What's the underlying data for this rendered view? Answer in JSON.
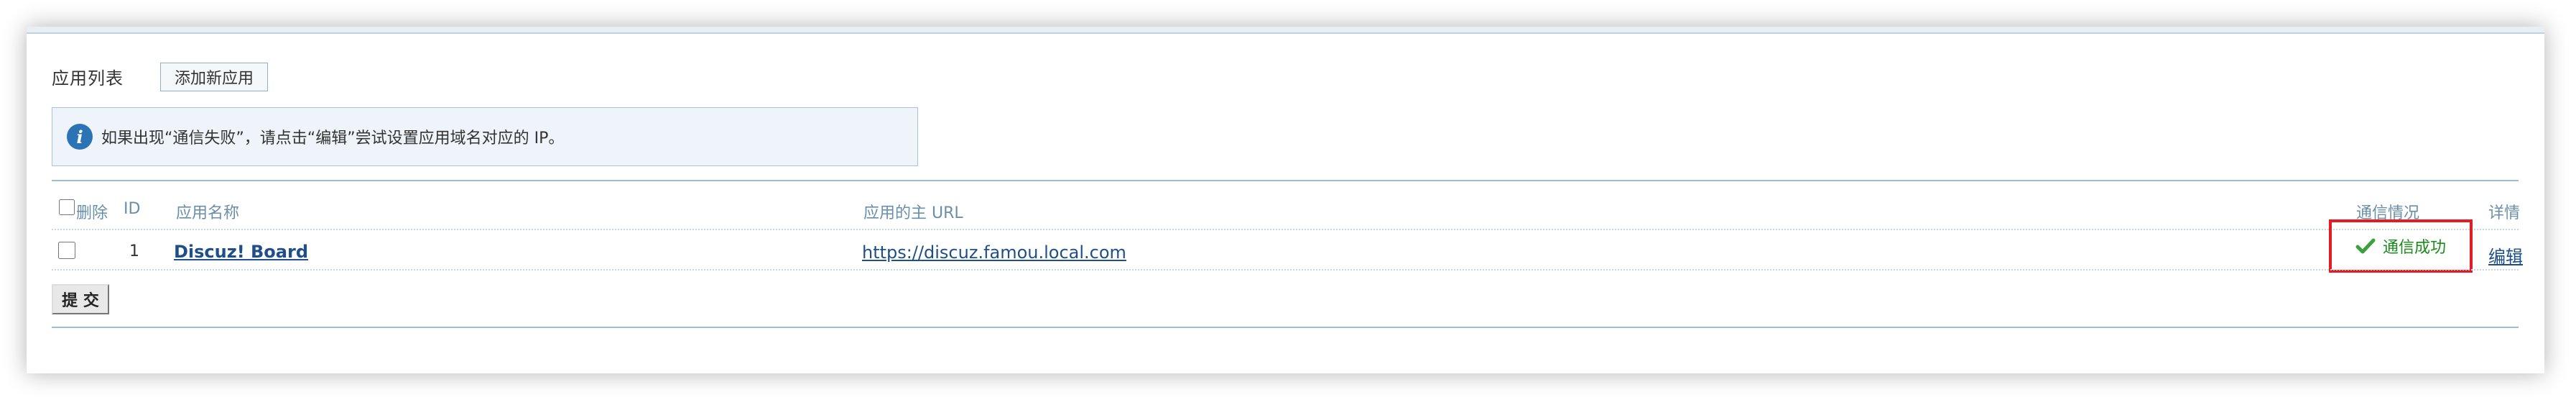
{
  "panel": {
    "title": "应用列表",
    "add_button_label": "添加新应用"
  },
  "notice": {
    "icon": "info-icon",
    "icon_glyph": "i",
    "text": "如果出现“通信失败”，请点击“编辑”尝试设置应用域名对应的 IP。"
  },
  "table": {
    "headers": {
      "delete": "删除",
      "id": "ID",
      "name": "应用名称",
      "url": "应用的主 URL",
      "status": "通信情况",
      "detail": "详情"
    },
    "rows": [
      {
        "checked": false,
        "id": "1",
        "name": "Discuz! Board",
        "url": "https://discuz.famou.local.com",
        "status": "通信成功",
        "status_icon": "checkmark-icon",
        "action": "编辑"
      }
    ]
  },
  "submit_label": "提 交",
  "colors": {
    "link": "#1f4f8a",
    "success": "#1a8a1a",
    "highlight_border": "#e31b23",
    "rule": "#9cbdd3",
    "header_text": "#6a8fa9"
  }
}
